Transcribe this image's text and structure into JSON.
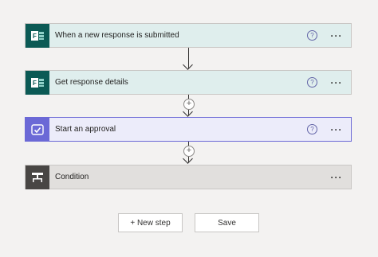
{
  "steps": [
    {
      "title": "When a new response is submitted",
      "help": "?",
      "more": "···",
      "icon": "forms-icon"
    },
    {
      "title": "Get response details",
      "help": "?",
      "more": "···",
      "icon": "forms-icon"
    },
    {
      "title": "Start an approval",
      "help": "?",
      "more": "···",
      "icon": "approval-icon"
    },
    {
      "title": "Condition",
      "more": "···",
      "icon": "condition-icon"
    }
  ],
  "insert_symbol": "+",
  "buttons": {
    "new_step": "+ New step",
    "save": "Save"
  },
  "colors": {
    "forms_header": "#dfeeed",
    "forms_icon_bg": "#0b5a55",
    "approval_header": "#ececfa",
    "approval_accent": "#6b69d6",
    "condition_header": "#e1dfdd",
    "condition_icon_bg": "#484644",
    "canvas": "#f3f2f1"
  }
}
